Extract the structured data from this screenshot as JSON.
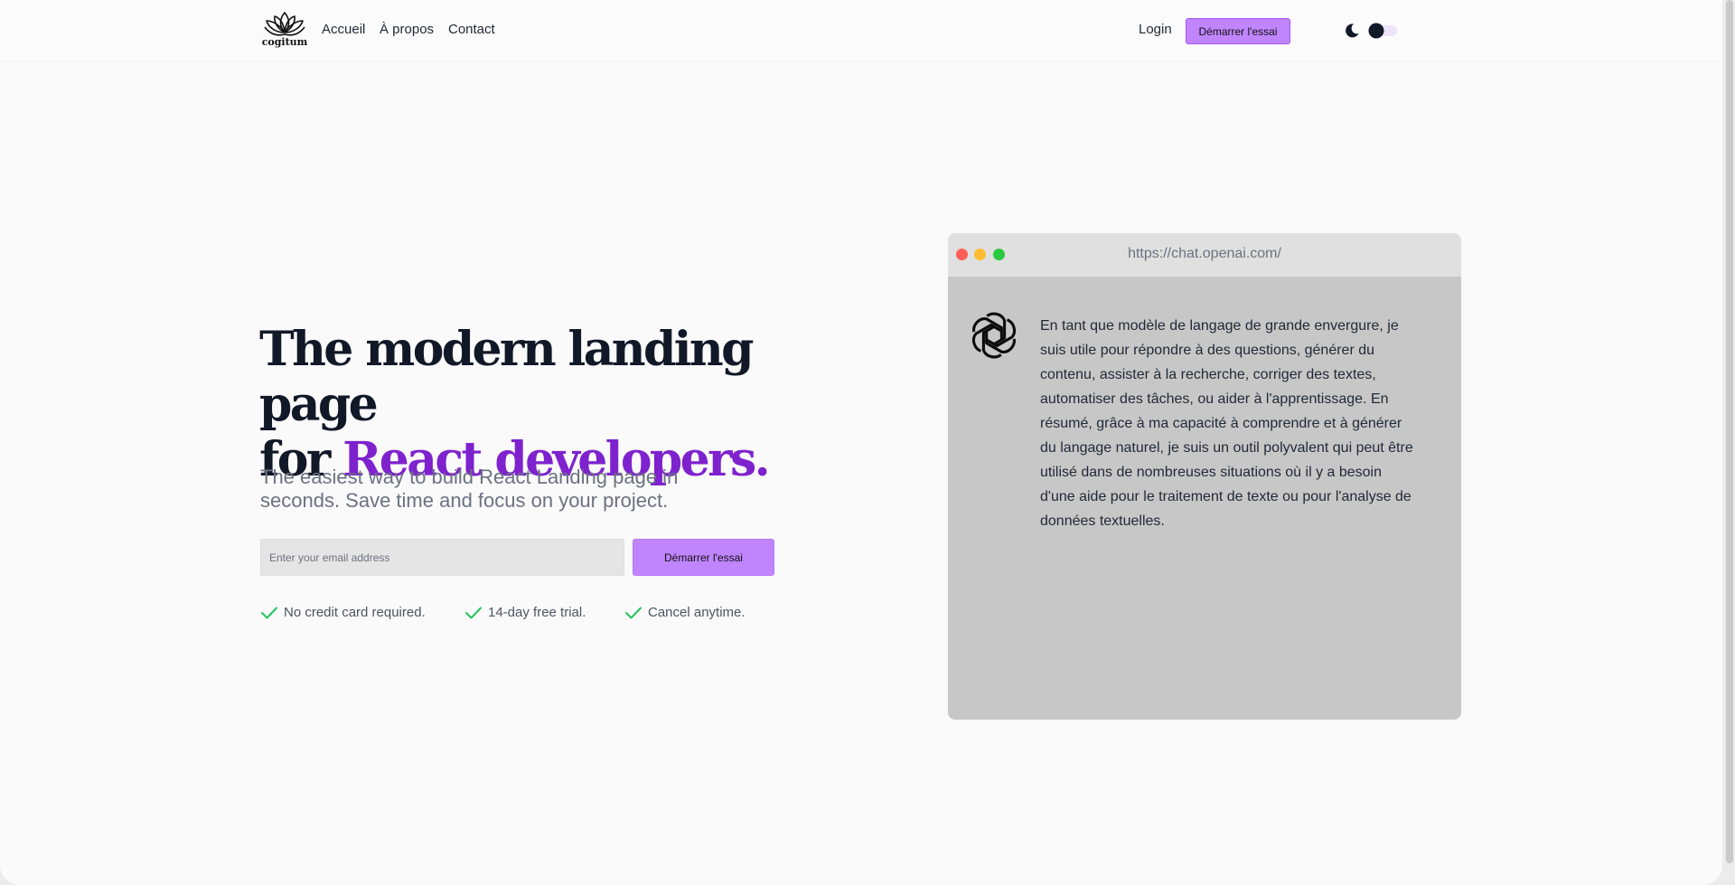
{
  "header": {
    "logo_alt": "cogitum",
    "nav": [
      "Accueil",
      "À propos",
      "Contact"
    ],
    "login_label": "Login",
    "cta_label": "Démarrer l'essai",
    "theme_toggle_icon": "moon-icon"
  },
  "hero": {
    "title_line1": "The modern landing page",
    "title_line2_prefix": "for ",
    "title_accent": "React developers.",
    "subtitle": "The easiest way to build React Landing page in seconds. Save time and focus on your project.",
    "email_placeholder": "Enter your email address",
    "cta_label": "Démarrer l'essai",
    "features": [
      "No credit card required.",
      "14-day free trial.",
      "Cancel anytime."
    ]
  },
  "browser": {
    "url": "https://chat.openai.com/",
    "message": "En tant que modèle de langage de grande envergure, je suis utile pour répondre à des questions, générer du contenu, assister à la recherche, corriger des textes, automatiser des tâches, ou aider à l'apprentissage. En résumé, grâce à ma capacité à comprendre et à générer du langage naturel, je suis un outil polyvalent qui peut être utilisé dans de nombreuses situations où il y a besoin d'une aide pour le traitement de texte ou pour l'analyse de données textuelles."
  },
  "colors": {
    "accent": "#7e22ce",
    "button_bg": "#c084fc",
    "check": "#22c55e",
    "dot_red": "#ff5f57",
    "dot_yellow": "#febc2e",
    "dot_green": "#28c840"
  }
}
